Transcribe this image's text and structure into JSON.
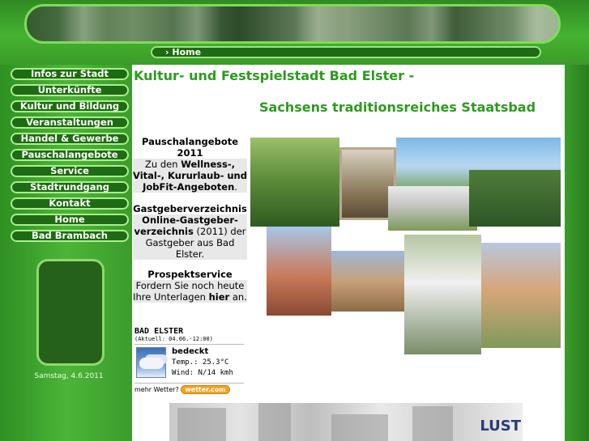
{
  "breadcrumb": {
    "home_label": "› Home"
  },
  "header": {
    "title_line1": "Kultur- und Festspielstadt Bad Elster -",
    "title_line2": "Sachsens traditionsreiches Staatsbad"
  },
  "nav": {
    "items": [
      {
        "label": "Infos zur Stadt"
      },
      {
        "label": "Unterkünfte"
      },
      {
        "label": "Kultur und Bildung"
      },
      {
        "label": "Veranstaltungen"
      },
      {
        "label": "Handel & Gewerbe"
      },
      {
        "label": "Pauschalangebote"
      },
      {
        "label": "Service"
      },
      {
        "label": "Stadtrundgang"
      },
      {
        "label": "Kontakt"
      },
      {
        "label": "Home"
      },
      {
        "label": "Bad Brambach"
      }
    ]
  },
  "sidebar": {
    "date": "Samstag, 4.6.2011"
  },
  "promos": {
    "pauschal": {
      "head": "Pauschalangebote 2011",
      "text_a": "Zu den ",
      "text_b": "Wellness-, Vital-, Kururlaub- und JobFit-Angeboten",
      "text_c": "."
    },
    "gastgeber": {
      "head": "Gastgeberverzeichnis",
      "text_b": "Online-Gastgeber-verzeichnis",
      "text_c": " (2011) der Gastgeber aus Bad Elster."
    },
    "prospekt": {
      "head": "Prospektservice",
      "text_a": "Fordern Sie noch heute Ihre Unterlagen ",
      "text_b": "hier",
      "text_c": " an."
    }
  },
  "weather": {
    "city": "BAD ELSTER",
    "updated": "(Aktuell: 04.06.-12:00)",
    "condition": "bedeckt",
    "temp": "Temp.: 25.3°C",
    "wind": "Wind: N/14 kmh",
    "more_label": "mehr Wetter?",
    "brand": "wetter.com"
  },
  "ad": {
    "brand": "LUST"
  },
  "colors": {
    "accent_green": "#2d9a1e",
    "nav_button": "#1f6a14",
    "side_green": "#46b232"
  }
}
